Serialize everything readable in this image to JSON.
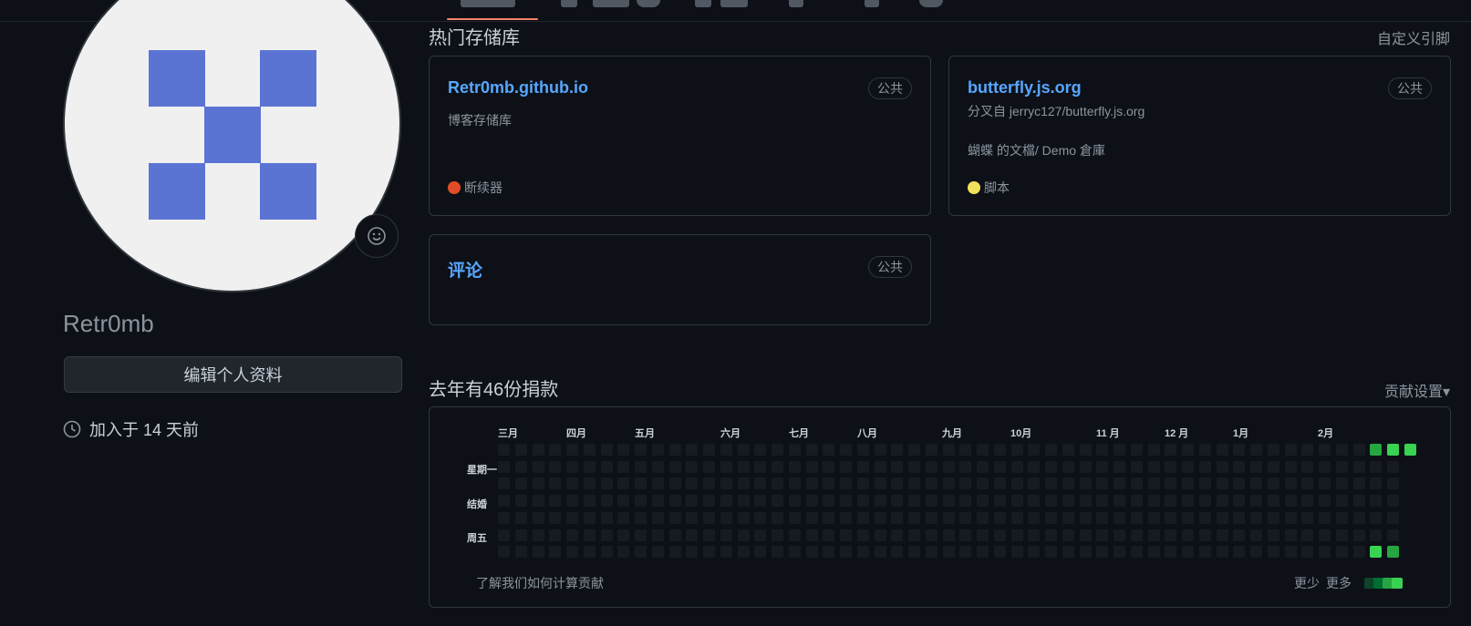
{
  "profile": {
    "username": "Retr0mb",
    "edit_label": "编辑个人资料",
    "joined": "加入于 14 天前",
    "status_icon": "smiley-icon",
    "avatar_color": "#5b74d4"
  },
  "pinned": {
    "title": "热门存储库",
    "customize_label": "自定义引脚",
    "repos": [
      {
        "name": "Retr0mb.github.io",
        "visibility": "公共",
        "description": "博客存储库",
        "language": "断续器",
        "language_color": "#e34c26"
      },
      {
        "name": "butterfly.js.org",
        "visibility": "公共",
        "forked_from": "分叉自 jerryc127/butterfly.js.org",
        "description": "蝴蝶 的文檔/ Demo 倉庫",
        "language": "脚本",
        "language_color": "#f1e05a"
      },
      {
        "name": "评论",
        "visibility": "公共"
      }
    ]
  },
  "contributions": {
    "title": "去年有46份捐款",
    "settings_label": "贡献设置▾",
    "months": [
      "三月",
      "四月",
      "五月",
      "六月",
      "七月",
      "八月",
      "九月",
      "10月",
      "11 月",
      "12 月",
      "1月",
      "2月"
    ],
    "day_labels": [
      "星期一",
      "结婚",
      "周五"
    ],
    "learn_label": "了解我们如何计算贡献",
    "legend_less": "更少",
    "legend_more": "更多",
    "colors": [
      "#161b22",
      "#0e4429",
      "#006d32",
      "#26a641",
      "#39d353"
    ]
  }
}
